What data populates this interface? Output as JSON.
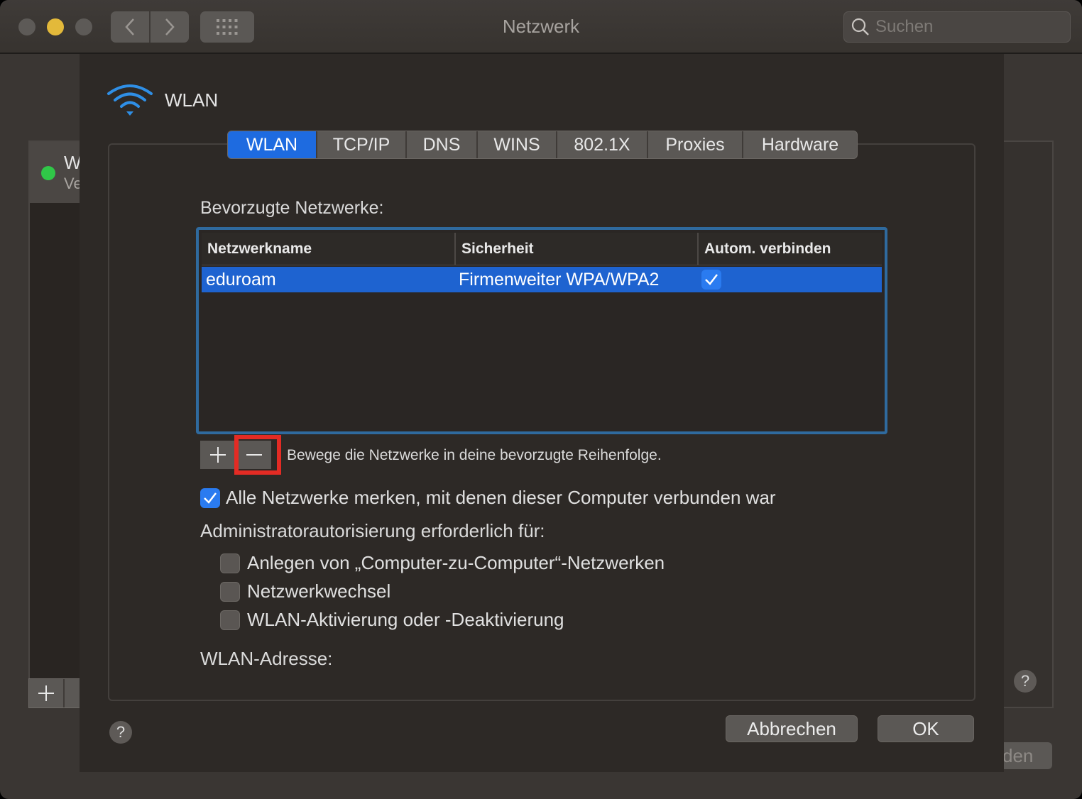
{
  "window": {
    "title": "Netzwerk",
    "search_placeholder": "Suchen"
  },
  "background": {
    "service_title": "W",
    "service_subtitle": "Ve",
    "partial_button": "den",
    "help": "?"
  },
  "sheet": {
    "title": "WLAN",
    "tabs": [
      {
        "label": "WLAN",
        "active": true
      },
      {
        "label": "TCP/IP",
        "active": false
      },
      {
        "label": "DNS",
        "active": false
      },
      {
        "label": "WINS",
        "active": false
      },
      {
        "label": "802.1X",
        "active": false
      },
      {
        "label": "Proxies",
        "active": false
      },
      {
        "label": "Hardware",
        "active": false
      }
    ],
    "preferred_label": "Bevorzugte Netzwerke:",
    "table": {
      "columns": [
        "Netzwerkname",
        "Sicherheit",
        "Autom. verbinden"
      ],
      "rows": [
        {
          "name": "eduroam",
          "security": "Firmenweiter WPA/WPA2",
          "auto_connect": true
        }
      ]
    },
    "reorder_hint": "Bewege die Netzwerke in deine bevorzugte Reihenfolge.",
    "remember_label": "Alle Netzwerke merken, mit denen dieser Computer verbunden war",
    "remember_checked": true,
    "admin_label": "Administratorautorisierung erforderlich für:",
    "admin_options": [
      {
        "label": "Anlegen von „Computer-zu-Computer“-Netzwerken",
        "checked": false
      },
      {
        "label": "Netzwerkwechsel",
        "checked": false
      },
      {
        "label": "WLAN-Aktivierung oder -Deaktivierung",
        "checked": false
      }
    ],
    "address_label": "WLAN-Adresse:",
    "help": "?",
    "cancel_label": "Abbrechen",
    "ok_label": "OK"
  },
  "colors": {
    "accent": "#1e6be0",
    "highlight_box": "#e32b24",
    "status_green": "#30c748"
  }
}
